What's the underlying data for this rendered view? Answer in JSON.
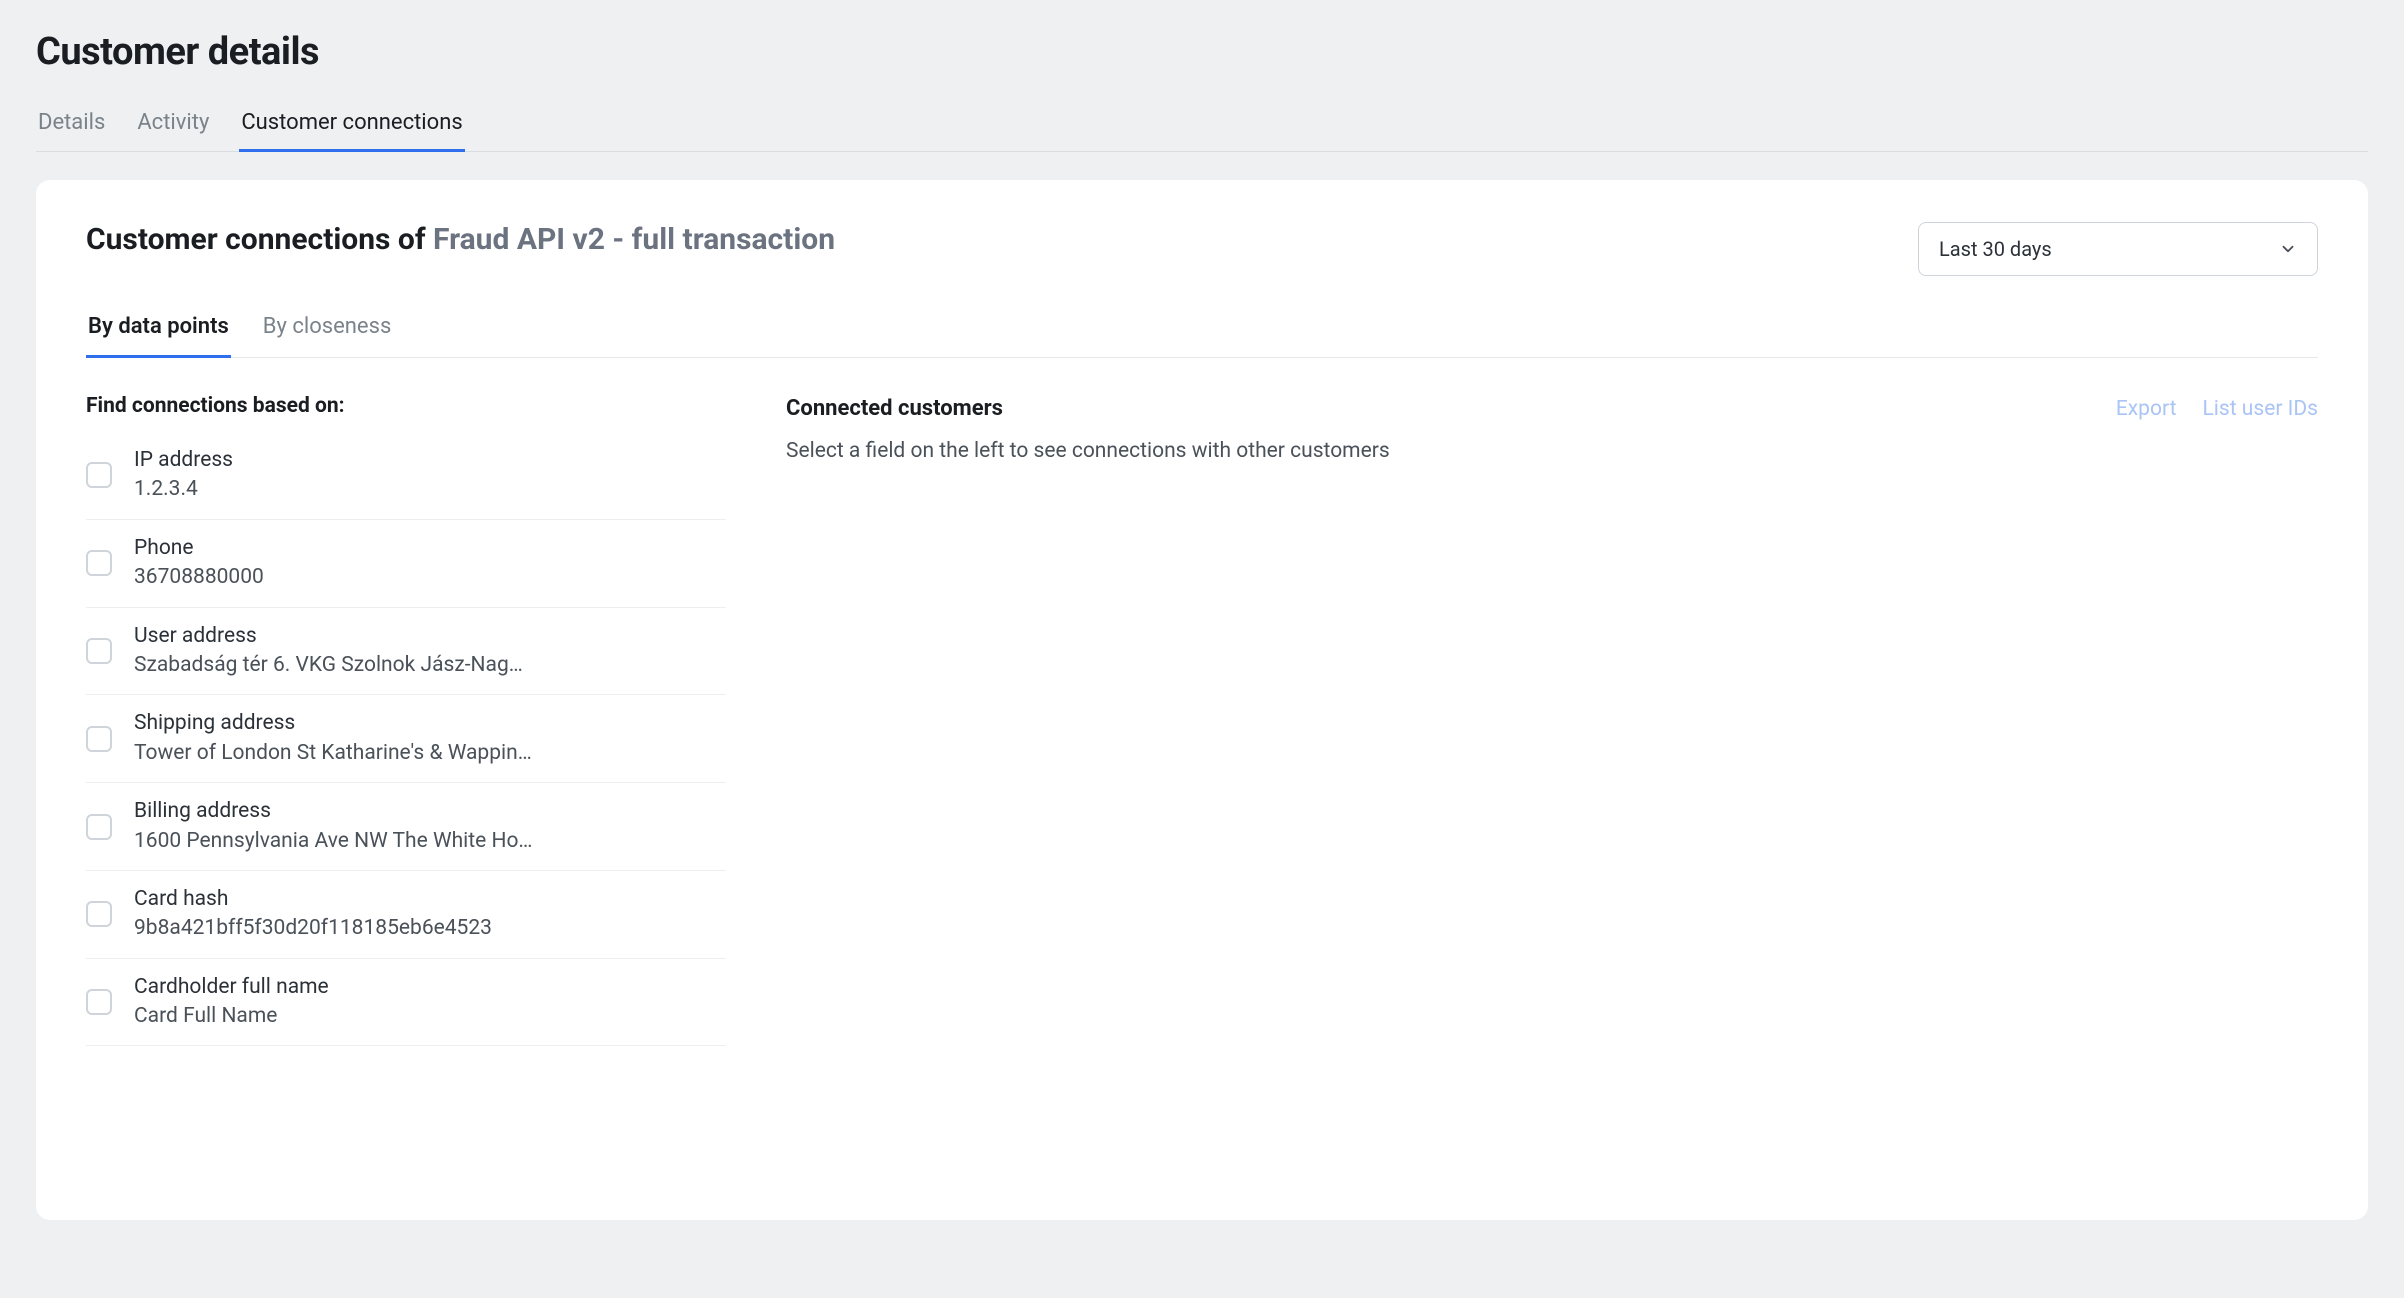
{
  "page": {
    "title": "Customer details"
  },
  "topTabs": [
    {
      "label": "Details",
      "active": false
    },
    {
      "label": "Activity",
      "active": false
    },
    {
      "label": "Customer connections",
      "active": true
    }
  ],
  "panel": {
    "titlePrefix": "Customer connections of ",
    "titleEntity": "Fraud API v2 - full transaction",
    "dateRange": "Last 30 days"
  },
  "subTabs": [
    {
      "label": "By data points",
      "active": true
    },
    {
      "label": "By closeness",
      "active": false
    }
  ],
  "findLabel": "Find connections based on:",
  "dataPoints": [
    {
      "title": "IP address",
      "value": "1.2.3.4"
    },
    {
      "title": "Phone",
      "value": "36708880000"
    },
    {
      "title": "User address",
      "value": "Szabadság tér 6. VKG Szolnok Jász-Nag…"
    },
    {
      "title": "Shipping address",
      "value": "Tower of London St Katharine's & Wappin…"
    },
    {
      "title": "Billing address",
      "value": "1600 Pennsylvania Ave NW The White Ho…"
    },
    {
      "title": "Card hash",
      "value": "9b8a421bff5f30d20f118185eb6e4523"
    },
    {
      "title": "Cardholder full name",
      "value": "Card Full Name"
    }
  ],
  "connected": {
    "title": "Connected customers",
    "exportLabel": "Export",
    "listIdsLabel": "List user IDs",
    "helperText": "Select a field on the left to see connections with other customers"
  }
}
